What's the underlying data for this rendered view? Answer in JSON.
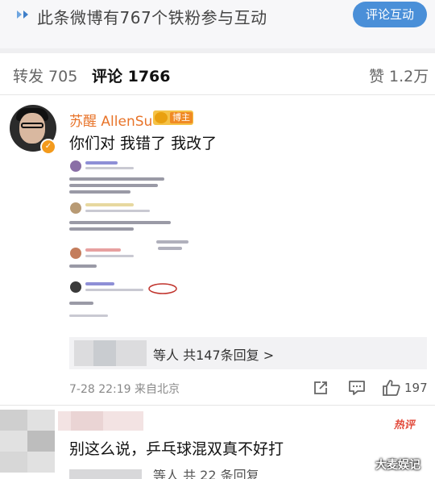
{
  "banner": {
    "title": "此条微博有767个铁粉参与互动",
    "button_label": "评论互动",
    "accent": "#4a8fd8"
  },
  "tabs": {
    "repost": "转发 705",
    "comments": "评论 1766",
    "likes": "赞 1.2万"
  },
  "comment1": {
    "username": "苏醒 AllenSu",
    "badge_label": "博主",
    "text": "你们对 我错了 我改了",
    "replies_text": "等人 共147条回复 >",
    "time": "7-28 22:19 来自北京",
    "like_count": "197",
    "username_color": "#e8742a"
  },
  "comment2": {
    "hot_label": "热评",
    "text": "别这么说，乒乓球混双真不好打",
    "more_text": "等人 共 22 条回复"
  },
  "watermark": "大麦娱记"
}
